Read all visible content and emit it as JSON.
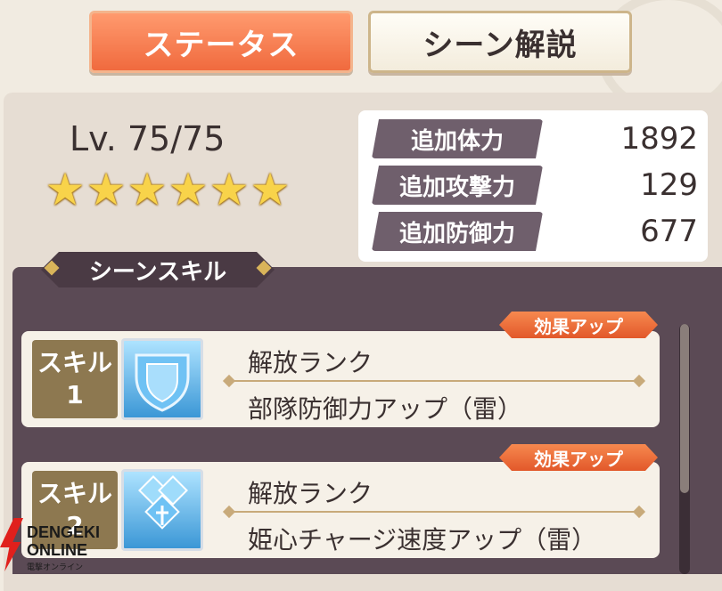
{
  "tabs": [
    {
      "label": "ステータス",
      "active": true
    },
    {
      "label": "シーン解説",
      "active": false
    }
  ],
  "status": {
    "level": "Lv. 75/75",
    "stars": 6,
    "stats": [
      {
        "label": "追加体力",
        "value": "1892"
      },
      {
        "label": "追加攻撃力",
        "value": "129"
      },
      {
        "label": "追加防御力",
        "value": "677"
      }
    ]
  },
  "scene_skill": {
    "header": "シーンスキル",
    "skills": [
      {
        "num_label": "スキル",
        "num": "1",
        "badge": "効果アップ",
        "title": "解放ランク",
        "desc": "部隊防御力アップ（雷）",
        "icon": "shield-icon"
      },
      {
        "num_label": "スキル",
        "num": "2",
        "badge": "効果アップ",
        "title": "解放ランク",
        "desc": "姫心チャージ速度アップ（雷）",
        "icon": "heart-charge-icon"
      }
    ]
  },
  "watermark": {
    "line1": "DENGEKI",
    "line2": "ONLINE",
    "line3": "電撃オンライン"
  },
  "colors": {
    "accent": "#f06a3e",
    "stat_label": "#6f5f6c",
    "skill_num": "#8d7850",
    "badge": "#e2582a"
  }
}
